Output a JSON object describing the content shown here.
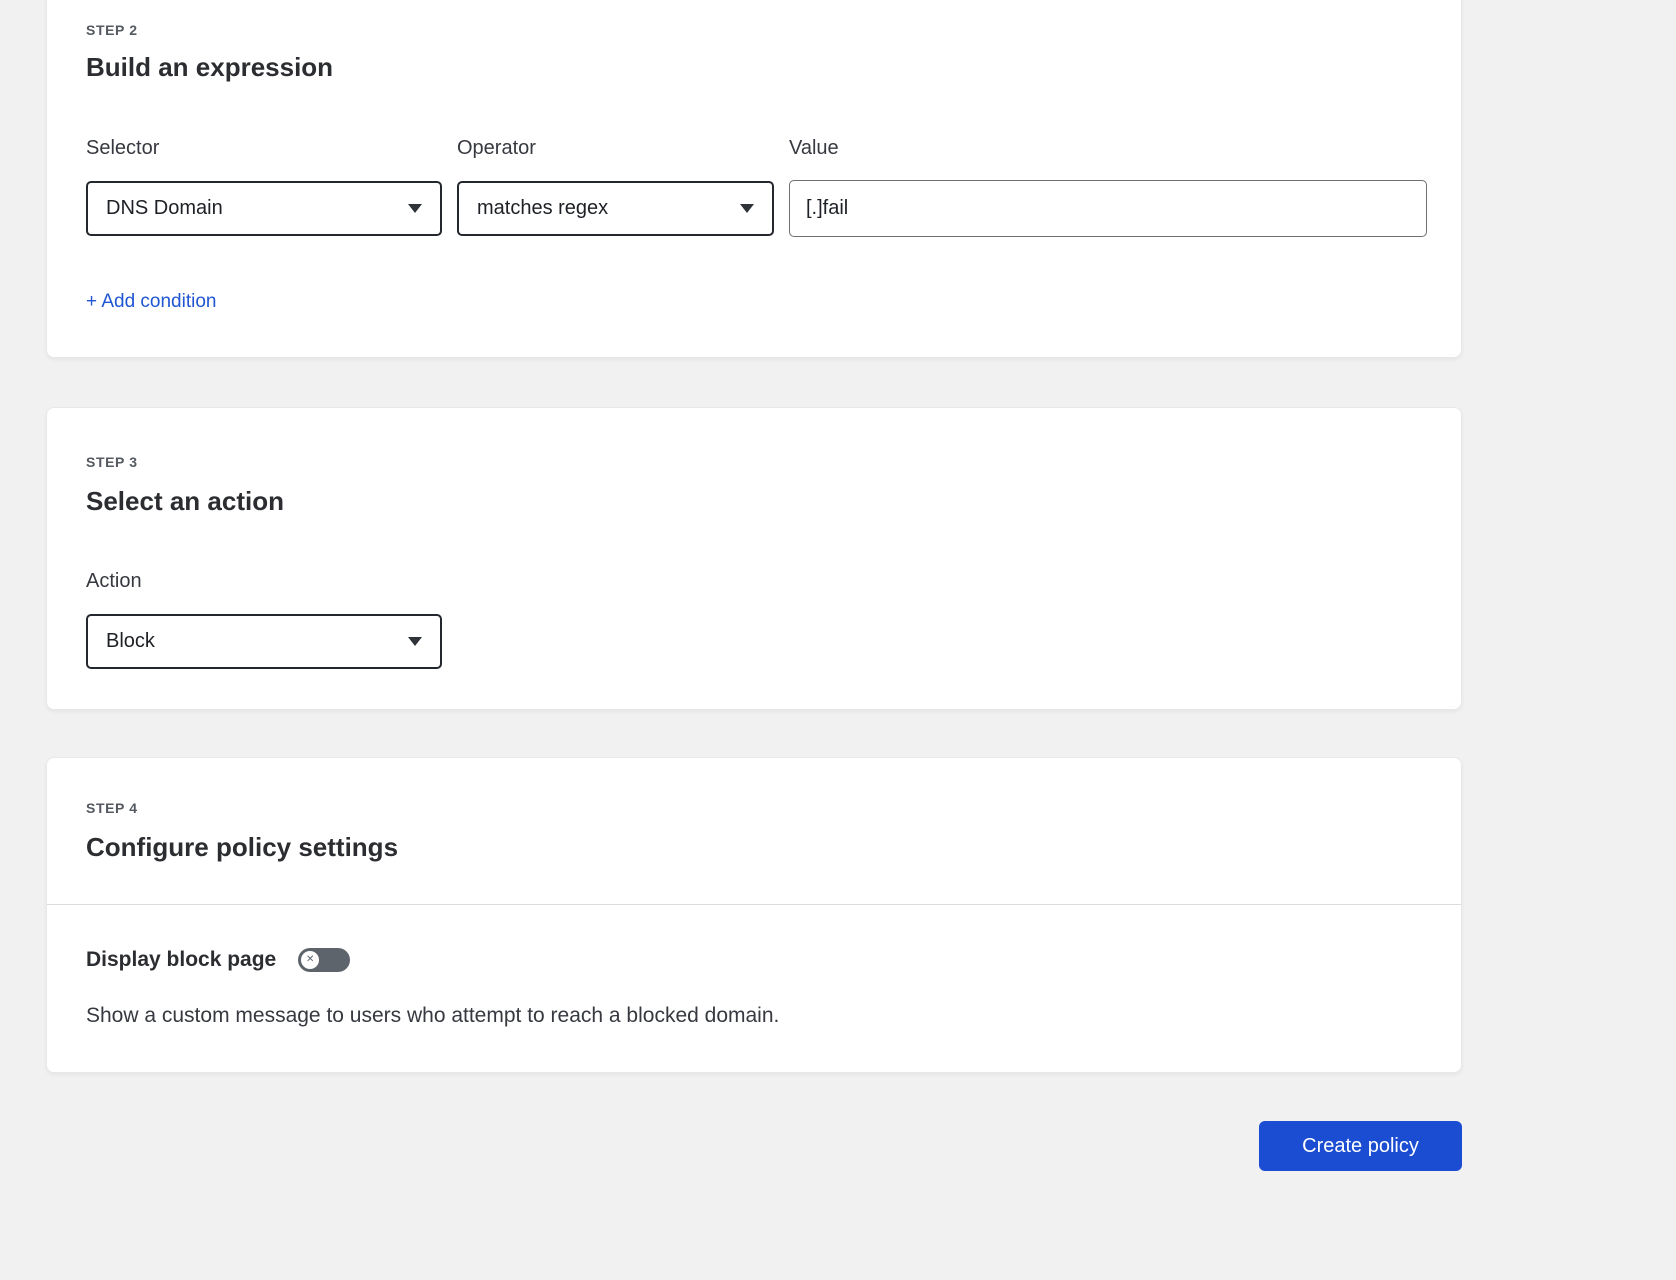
{
  "step2": {
    "step_label": "STEP 2",
    "title": "Build an expression",
    "selector_label": "Selector",
    "selector_value": "DNS Domain",
    "operator_label": "Operator",
    "operator_value": "matches regex",
    "value_label": "Value",
    "value_input": "[.]fail",
    "add_condition_label": "+ Add condition"
  },
  "step3": {
    "step_label": "STEP 3",
    "title": "Select an action",
    "action_label": "Action",
    "action_value": "Block"
  },
  "step4": {
    "step_label": "STEP 4",
    "title": "Configure policy settings",
    "block_page_label": "Display block page",
    "block_page_toggle_state": "off",
    "block_page_description": "Show a custom message to users who attempt to reach a blocked domain."
  },
  "footer": {
    "create_policy_label": "Create policy"
  },
  "colors": {
    "primary_button": "#1b4dd2",
    "link": "#2056d3",
    "toggle_off": "#5d646b",
    "bg": "#f1f1f1",
    "card_bg": "#ffffff"
  }
}
